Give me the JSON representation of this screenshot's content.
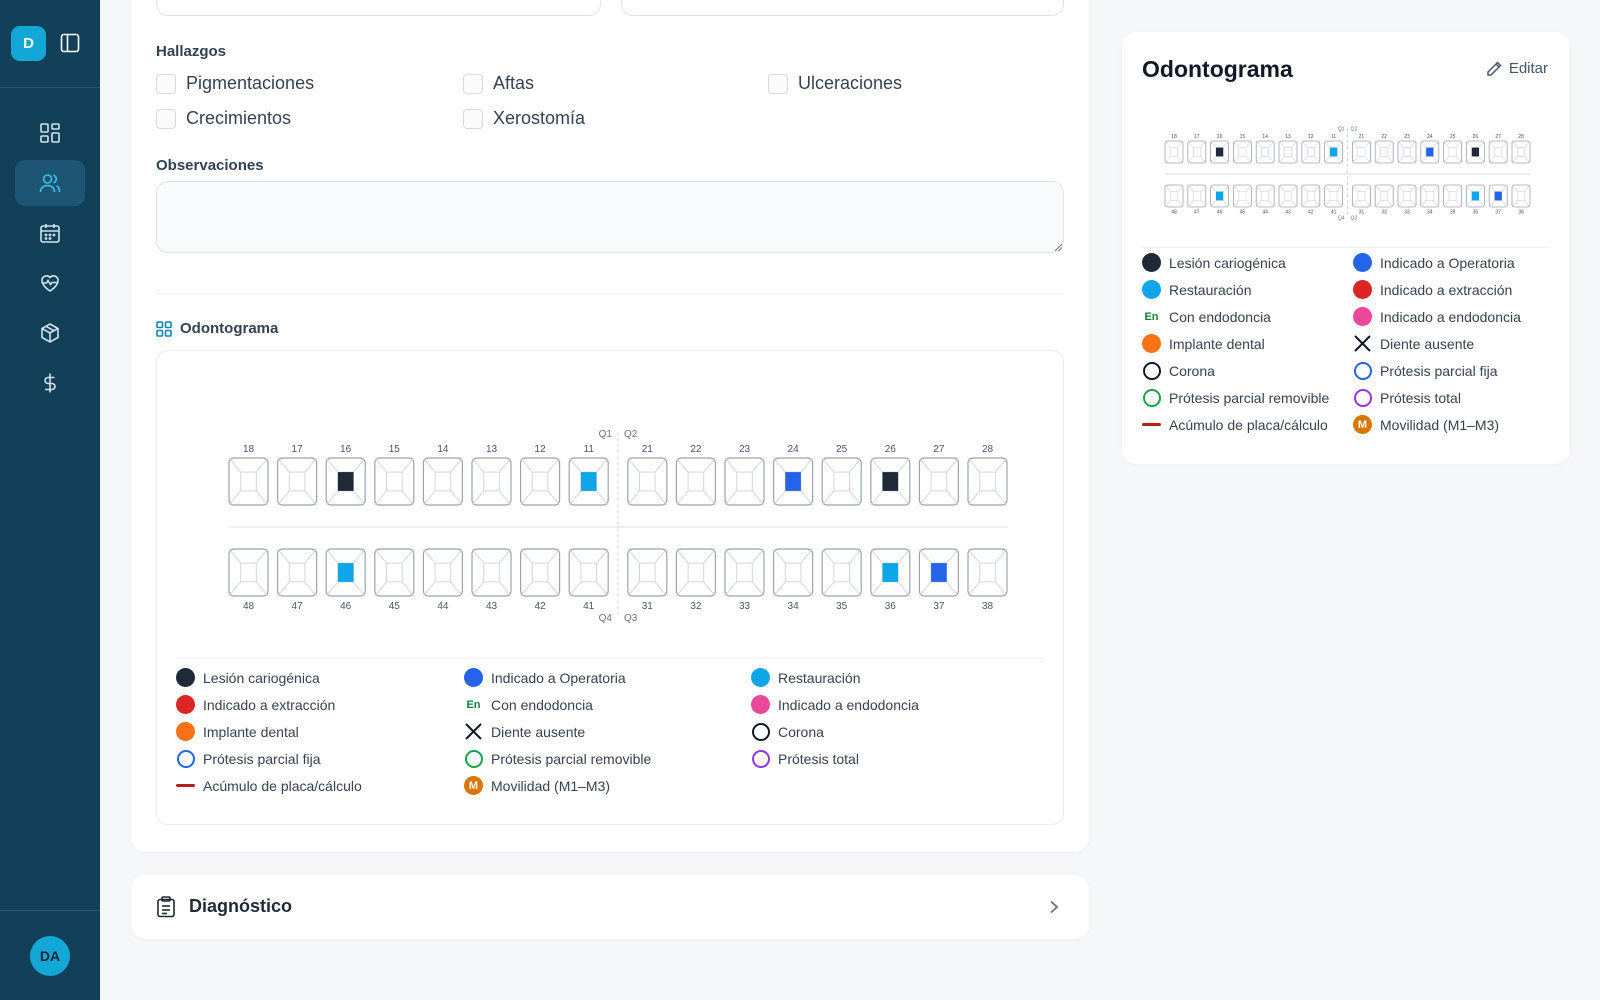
{
  "sidebar": {
    "logo_letter": "D",
    "user_initials": "DA",
    "nav": [
      {
        "name": "dashboard",
        "icon": "grid-icon",
        "active": false
      },
      {
        "name": "patients",
        "icon": "users-icon",
        "active": true
      },
      {
        "name": "calendar",
        "icon": "calendar-icon",
        "active": false
      },
      {
        "name": "health",
        "icon": "heart-pulse-icon",
        "active": false
      },
      {
        "name": "inventory",
        "icon": "box-icon",
        "active": false
      },
      {
        "name": "billing",
        "icon": "dollar-icon",
        "active": false
      }
    ]
  },
  "findings": {
    "label": "Hallazgos",
    "items": [
      "Pigmentaciones",
      "Aftas",
      "Ulceraciones",
      "Crecimientos",
      "Xerostomía"
    ]
  },
  "observations": {
    "label": "Observaciones",
    "value": ""
  },
  "odontogram_section": {
    "title": "Odontograma",
    "quadrants": {
      "q1": "Q1",
      "q2": "Q2",
      "q3": "Q3",
      "q4": "Q4"
    },
    "upper": [
      "18",
      "17",
      "16",
      "15",
      "14",
      "13",
      "12",
      "11",
      "21",
      "22",
      "23",
      "24",
      "25",
      "26",
      "27",
      "28"
    ],
    "lower": [
      "48",
      "47",
      "46",
      "45",
      "44",
      "43",
      "42",
      "41",
      "31",
      "32",
      "33",
      "34",
      "35",
      "36",
      "37",
      "38"
    ],
    "upper_marks": {
      "16": "lesion",
      "11": "restoration",
      "24": "operatoria",
      "26": "lesion"
    },
    "lower_marks": {
      "46": "restoration",
      "36": "restoration",
      "37": "operatoria"
    }
  },
  "legend": [
    {
      "key": "lesion",
      "label": "Lesión cariogénica",
      "type": "dot",
      "color": "#1f2937"
    },
    {
      "key": "operatoria",
      "label": "Indicado a Operatoria",
      "type": "dot",
      "color": "#2563eb"
    },
    {
      "key": "restoration",
      "label": "Restauración",
      "type": "dot",
      "color": "#0ea5e9"
    },
    {
      "key": "extraccion",
      "label": "Indicado a extracción",
      "type": "dot",
      "color": "#dc2626"
    },
    {
      "key": "endodoncia_con",
      "label": "Con endodoncia",
      "type": "text",
      "symbol": "En",
      "color": "#15803d"
    },
    {
      "key": "endodoncia_ind",
      "label": "Indicado a endodoncia",
      "type": "dot",
      "color": "#ec4899"
    },
    {
      "key": "implante",
      "label": "Implante dental",
      "type": "dot",
      "color": "#f97316"
    },
    {
      "key": "ausente",
      "label": "Diente ausente",
      "type": "x",
      "color": "#111827"
    },
    {
      "key": "corona",
      "label": "Corona",
      "type": "ring",
      "color": "#111827"
    },
    {
      "key": "ppf",
      "label": "Prótesis parcial fija",
      "type": "ring",
      "color": "#2563eb"
    },
    {
      "key": "ppr",
      "label": "Prótesis parcial removible",
      "type": "ring",
      "color": "#16a34a"
    },
    {
      "key": "pt",
      "label": "Prótesis total",
      "type": "ring",
      "color": "#9333ea"
    },
    {
      "key": "placa",
      "label": "Acúmulo de placa/cálculo",
      "type": "bar",
      "color": "#b91c1c"
    },
    {
      "key": "movilidad",
      "label": "Movilidad (M1–M3)",
      "type": "badge",
      "symbol": "M",
      "color": "#d97706"
    }
  ],
  "diagnostic": {
    "title": "Diagnóstico"
  },
  "right_panel": {
    "title": "Odontograma",
    "edit_label": "Editar"
  },
  "colors": {
    "sidebar_bg": "#134059",
    "accent": "#12a7d6"
  }
}
